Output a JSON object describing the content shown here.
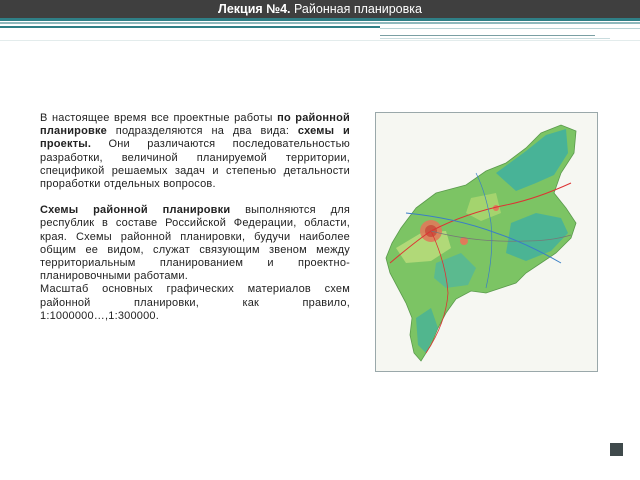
{
  "title": {
    "bold": "Лекция №4.",
    "rest": " Районная планировка"
  },
  "paragraph1": {
    "t1": "В настоящее время все проектные работы ",
    "b1": "по районной планировке",
    "t2": " подразделяются на два вида: ",
    "b2": "схемы и проекты.",
    "t3": " Они различаются последовательностью разработки, величиной планируемой территории, спецификой решаемых задач и степенью детальности проработки отдельных вопросов."
  },
  "paragraph2": {
    "b1": "Схемы районной планировки",
    "t1": " выполняются для республик в составе Российской Федерации, области, края. Схемы районной планировки, будучи наиболее общим ее видом, служат связующим звеном между территориальным планированием и проектно-планировочными работами.",
    "t2": "Масштаб основных графических материалов схем районной планировки, как правило, 1:1000000…,1:300000."
  },
  "colors": {
    "title_bar": "#3f3f3f",
    "accent": "#2f7f86",
    "map_green": "#6fbf5a",
    "map_teal": "#3fb0a0"
  }
}
